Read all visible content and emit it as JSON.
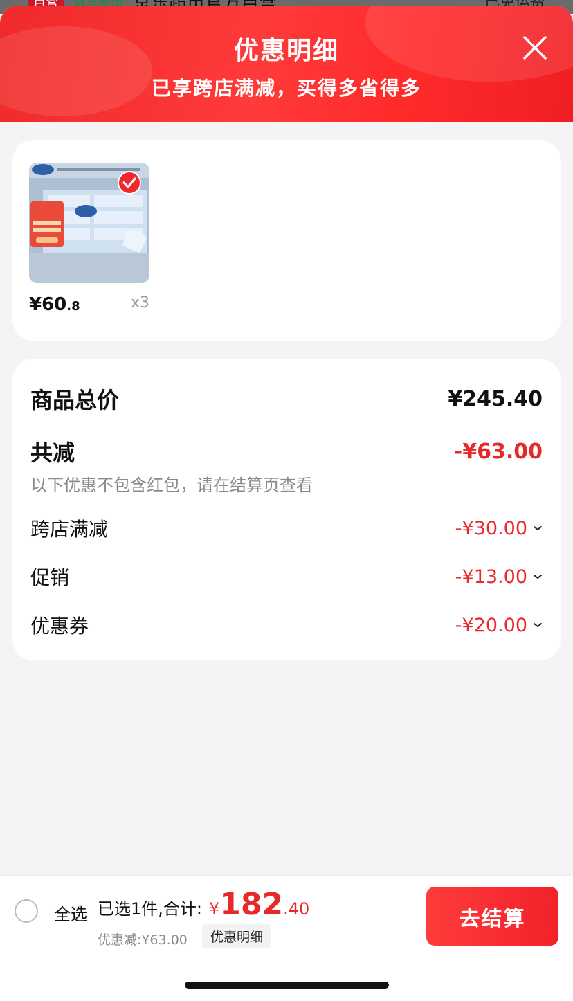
{
  "underlying": {
    "badge_self": "自营",
    "badge_mart": "京东超市",
    "store_name": "京东超市官方自营",
    "shipping": "已免运费"
  },
  "header": {
    "title": "优惠明细",
    "subtitle": "已享跨店满减，买得多省得多",
    "close_icon": "close-icon"
  },
  "product": {
    "price_int": "¥60",
    "price_dec": ".8",
    "qty": "x3",
    "selected": true
  },
  "summary": {
    "total_label": "商品总价",
    "total_value": "¥245.40",
    "reduce_label": "共减",
    "reduce_value": "-¥63.00",
    "note": "以下优惠不包含红包，请在结算页查看",
    "items": [
      {
        "label": "跨店满减",
        "value": "-¥30.00"
      },
      {
        "label": "促销",
        "value": "-¥13.00"
      },
      {
        "label": "优惠券",
        "value": "-¥20.00"
      }
    ]
  },
  "bottom": {
    "select_all": "全选",
    "selected_info": "已选1件,合计:",
    "total_currency": "¥",
    "total_int": "182",
    "total_dec": ".40",
    "discount_line": "优惠减:¥63.00",
    "detail_tag": "优惠明细",
    "checkout": "去结算"
  },
  "colors": {
    "accent": "#e8292a",
    "header_red": "#ff3a3a"
  }
}
